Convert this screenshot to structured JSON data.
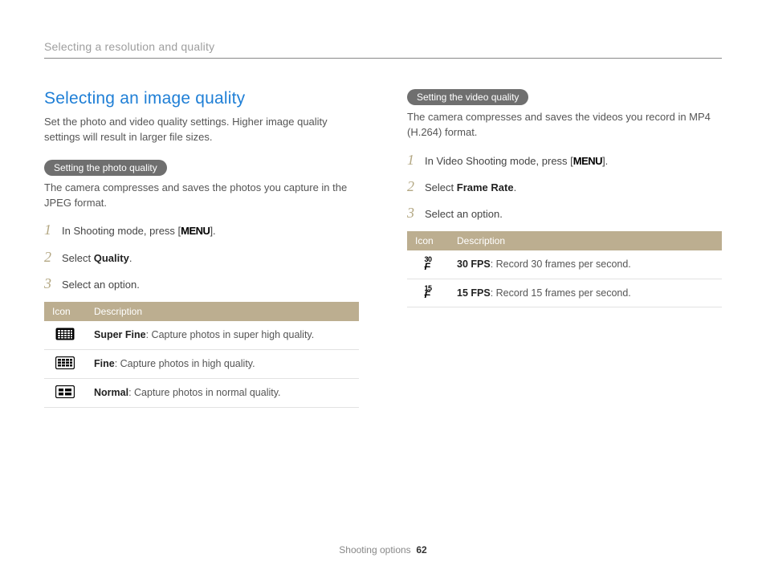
{
  "header": {
    "running_head": "Selecting a resolution and quality"
  },
  "left": {
    "title": "Selecting an image quality",
    "intro": "Set the photo and video quality settings. Higher image quality settings will result in larger file sizes.",
    "pill": "Setting the photo quality",
    "subintro": "The camera compresses and saves the photos you capture in the JPEG format.",
    "steps": {
      "s1_a": "In Shooting mode, press [",
      "s1_menu": "MENU",
      "s1_b": "].",
      "s2_a": "Select ",
      "s2_bold": "Quality",
      "s2_b": ".",
      "s3": "Select an option."
    },
    "table": {
      "h_icon": "Icon",
      "h_desc": "Description",
      "rows": [
        {
          "bold": "Super Fine",
          "rest": ": Capture photos in super high quality."
        },
        {
          "bold": "Fine",
          "rest": ": Capture photos in high quality."
        },
        {
          "bold": "Normal",
          "rest": ": Capture photos in normal quality."
        }
      ]
    }
  },
  "right": {
    "pill": "Setting the video quality",
    "subintro": "The camera compresses and saves the videos you record in MP4 (H.264) format.",
    "steps": {
      "s1_a": "In Video Shooting mode, press [",
      "s1_menu": "MENU",
      "s1_b": "].",
      "s2_a": "Select ",
      "s2_bold": "Frame Rate",
      "s2_b": ".",
      "s3": "Select an option."
    },
    "table": {
      "h_icon": "Icon",
      "h_desc": "Description",
      "rows": [
        {
          "fps": "30",
          "bold": "30 FPS",
          "rest": ": Record 30 frames per second."
        },
        {
          "fps": "15",
          "bold": "15 FPS",
          "rest": ": Record 15 frames per second."
        }
      ]
    }
  },
  "footer": {
    "section": "Shooting options",
    "page": "62"
  }
}
